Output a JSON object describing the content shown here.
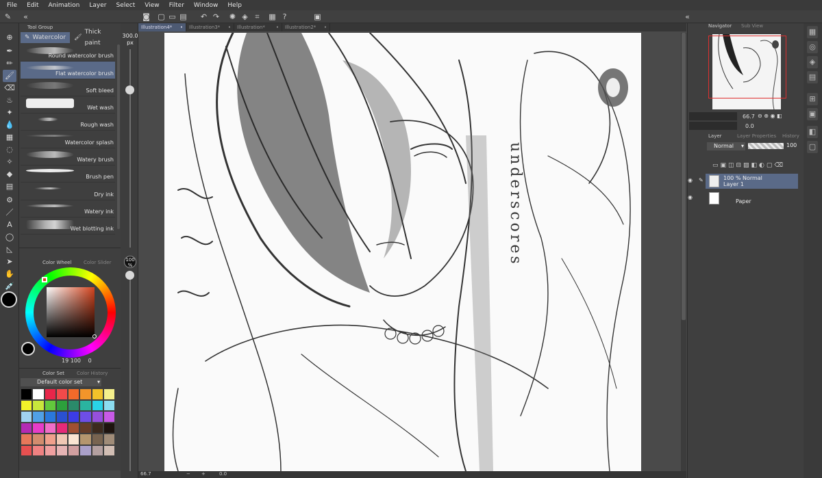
{
  "menu": [
    "File",
    "Edit",
    "Animation",
    "Layer",
    "Select",
    "View",
    "Filter",
    "Window",
    "Help"
  ],
  "tool_panel": {
    "tab_label": "Tool Group"
  },
  "sub_tool": {
    "tabs": [
      {
        "label": "Watercolor",
        "active": true
      },
      {
        "label": "Thick paint",
        "active": false
      }
    ],
    "brushes": [
      {
        "label": "Round watercolor brush",
        "active": false
      },
      {
        "label": "Flat watercolor brush",
        "active": true
      },
      {
        "label": "Soft bleed",
        "active": false
      },
      {
        "label": "Wet wash",
        "active": false
      },
      {
        "label": "Rough wash",
        "active": false
      },
      {
        "label": "Watercolor splash",
        "active": false
      },
      {
        "label": "Watery brush",
        "active": false
      },
      {
        "label": "Brush pen",
        "active": false
      },
      {
        "label": "Dry ink",
        "active": false
      },
      {
        "label": "Watery ink",
        "active": false
      },
      {
        "label": "Wet blotting ink",
        "active": false
      }
    ]
  },
  "brush_size": {
    "value": "300.0",
    "unit": "px"
  },
  "brush_opacity": {
    "value": "100",
    "unit": "%"
  },
  "color_wheel": {
    "tabs": [
      "Color Wheel",
      "Color Slider"
    ],
    "hue": "19",
    "saturation": "100",
    "value": "0"
  },
  "color_set": {
    "tabs": [
      "Color Set",
      "Color History"
    ],
    "selected": "Default color set",
    "swatches": [
      "#000000",
      "#ffffff",
      "#e8264a",
      "#f24a4a",
      "#f26a2a",
      "#f2952a",
      "#f2c22a",
      "#f5f08c",
      "#f2f22a",
      "#c8e63c",
      "#62c83c",
      "#2ca03c",
      "#2a8a6a",
      "#2ab4a0",
      "#2ad2e6",
      "#8cdcf0",
      "#a0d2f0",
      "#50a0e6",
      "#2a78dc",
      "#2a50d2",
      "#3c3ce6",
      "#6e4ee6",
      "#9650dc",
      "#c85ae6",
      "#b42ab4",
      "#e63cc8",
      "#f06ec8",
      "#e62a78",
      "#a05032",
      "#643c28",
      "#3c2a1e",
      "#1e140f",
      "#e6785a",
      "#d28c6e",
      "#f0a08c",
      "#f0c8b4",
      "#fae6d2",
      "#b4966e",
      "#786450",
      "#a08c78",
      "#e65050",
      "#f08282",
      "#f0a0a0",
      "#e6b4b4",
      "#d2a0a0",
      "#aaa0c8",
      "#b4a0a0",
      "#d2beb4"
    ]
  },
  "documents": [
    {
      "label": "Illustration4*",
      "active": true
    },
    {
      "label": "Illustration3*",
      "active": false
    },
    {
      "label": "Illustration*",
      "active": false
    },
    {
      "label": "Illustration2*",
      "active": false
    }
  ],
  "canvas": {
    "text_vertical": "underscores"
  },
  "status": {
    "zoom": "66.7",
    "rotation": "0.0"
  },
  "navigator": {
    "tabs": [
      "Navigator",
      "Sub View"
    ],
    "zoom": "66.7",
    "rotation": "0.0"
  },
  "layers_panel": {
    "tabs": [
      "Layer",
      "Layer Properties",
      "History"
    ],
    "blend_mode": "Normal",
    "opacity": "100",
    "layers": [
      {
        "line1": "100 % Normal",
        "line2": "Layer 1",
        "active": true
      },
      {
        "line1": "",
        "line2": "Paper",
        "active": false
      }
    ]
  }
}
